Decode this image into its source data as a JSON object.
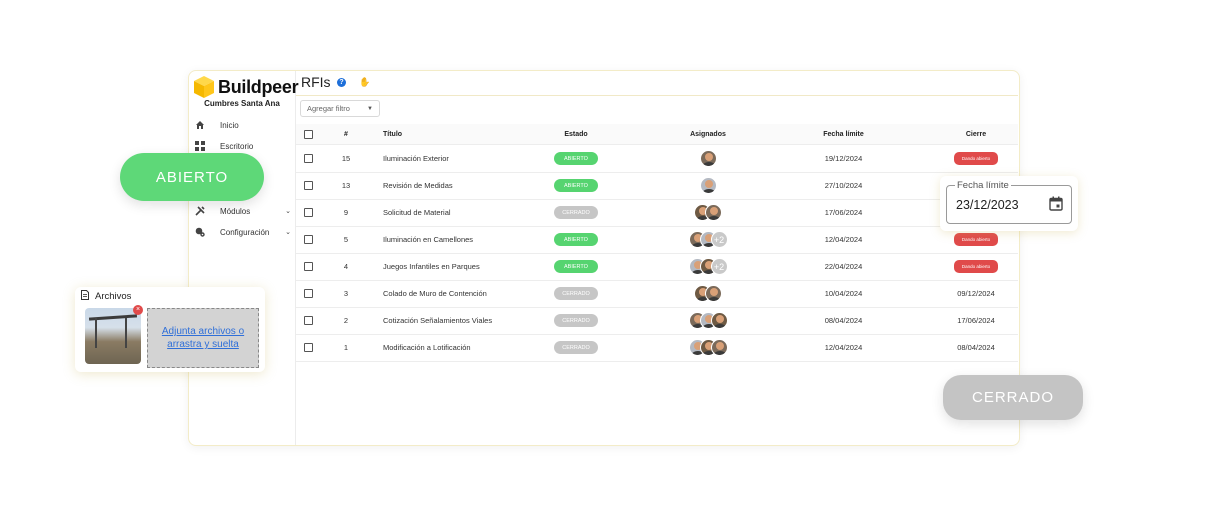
{
  "app": {
    "brand": "Buildpeer",
    "project": "Cumbres Santa Ana"
  },
  "sidebar": {
    "items": [
      {
        "label": "Inicio",
        "icon": "home-icon"
      },
      {
        "label": "Escritorio",
        "icon": "grid-icon"
      },
      {
        "label": "Módulos",
        "icon": "tools-icon"
      },
      {
        "label": "Configuración",
        "icon": "settings-icon"
      }
    ]
  },
  "header": {
    "title": "RFIs",
    "filter_placeholder": "Agregar filtro"
  },
  "table": {
    "columns": [
      "#",
      "Título",
      "Estado",
      "Asignados",
      "Fecha límite",
      "Cierre"
    ],
    "rows": [
      {
        "num": "15",
        "title": "Iluminación Exterior",
        "estado": "ABIERTO",
        "status": "open",
        "avatars": 1,
        "extra": "",
        "fecha": "19/12/2024",
        "cierre": "Dando abierto"
      },
      {
        "num": "13",
        "title": "Revisión de Medidas",
        "estado": "ABIERTO",
        "status": "open",
        "avatars": 1,
        "extra": "",
        "fecha": "27/10/2024",
        "cierre": ""
      },
      {
        "num": "9",
        "title": "Solicitud de Material",
        "estado": "CERRADO",
        "status": "closed",
        "avatars": 2,
        "extra": "",
        "fecha": "17/06/2024",
        "cierre": ""
      },
      {
        "num": "5",
        "title": "Iluminación en Camellones",
        "estado": "ABIERTO",
        "status": "open",
        "avatars": 2,
        "extra": "+2",
        "fecha": "12/04/2024",
        "cierre": "Dando abierto"
      },
      {
        "num": "4",
        "title": "Juegos Infantiles en Parques",
        "estado": "ABIERTO",
        "status": "open",
        "avatars": 2,
        "extra": "+2",
        "fecha": "22/04/2024",
        "cierre": "Dando abierto"
      },
      {
        "num": "3",
        "title": "Colado de Muro de Contención",
        "estado": "CERRADO",
        "status": "closed",
        "avatars": 2,
        "extra": "",
        "fecha": "10/04/2024",
        "cierre": "09/12/2024"
      },
      {
        "num": "2",
        "title": "Cotización Señalamientos Viales",
        "estado": "CERRADO",
        "status": "closed",
        "avatars": 3,
        "extra": "",
        "fecha": "08/04/2024",
        "cierre": "17/06/2024"
      },
      {
        "num": "1",
        "title": "Modificación a Lotificación",
        "estado": "CERRADO",
        "status": "closed",
        "avatars": 3,
        "extra": "",
        "fecha": "12/04/2024",
        "cierre": "08/04/2024"
      }
    ]
  },
  "overlays": {
    "abierto_pill": "ABIERTO",
    "cerrado_pill": "CERRADO",
    "date_label": "Fecha límite",
    "date_value": "23/12/2023",
    "files_title": "Archivos",
    "dropzone_text": "Adjunta archivos o arrastra y suelta"
  },
  "colors": {
    "open": "#56d470",
    "closed": "#c6c6c6",
    "danger": "#e04a4a",
    "link": "#2f6fd8",
    "accent_border": "#f3ecc8"
  }
}
